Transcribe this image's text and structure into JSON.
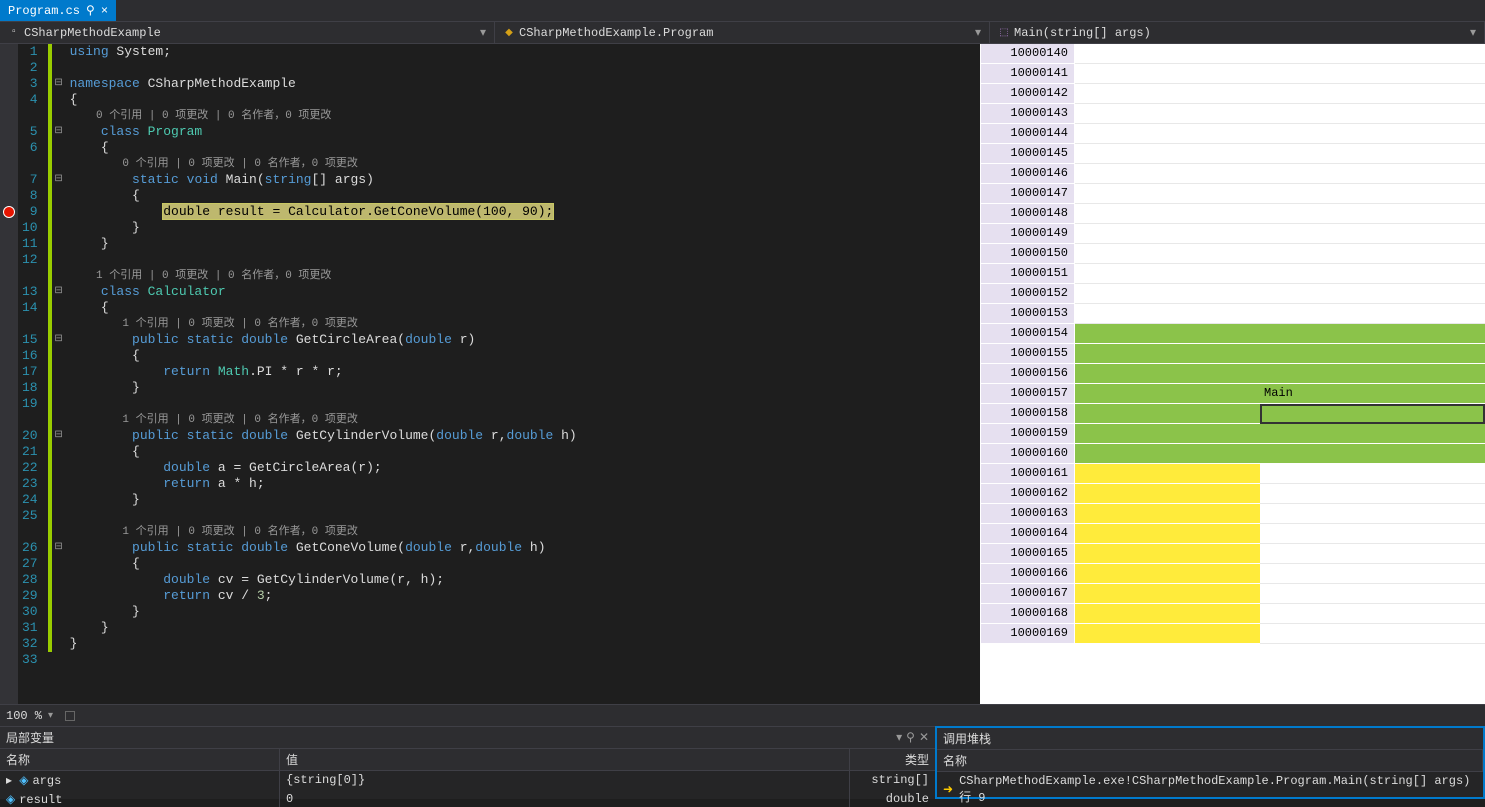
{
  "tab": {
    "name": "Program.cs",
    "close": "×"
  },
  "breadcrumb": {
    "project": "CSharpMethodExample",
    "class": "CSharpMethodExample.Program",
    "method": "Main(string[] args)"
  },
  "icons": {
    "ns": "▫",
    "cls": "◆",
    "meth": "⬚",
    "chev": "▾",
    "fold": "⊟",
    "foldc": "⊞",
    "pin": "⚲",
    "close": "✕",
    "tri": "▸",
    "cube": "◈",
    "arrow": "➜"
  },
  "code": {
    "lines": [
      {
        "n": 1,
        "fold": "",
        "chg": "mod",
        "parts": [
          {
            "t": "using ",
            "c": "kw"
          },
          {
            "t": "System;",
            "c": ""
          }
        ]
      },
      {
        "n": 2,
        "fold": "",
        "chg": "mod",
        "parts": []
      },
      {
        "n": 3,
        "fold": "⊟",
        "chg": "mod",
        "parts": [
          {
            "t": "namespace ",
            "c": "kw"
          },
          {
            "t": "CSharpMethodExample",
            "c": ""
          }
        ]
      },
      {
        "n": 4,
        "fold": "",
        "chg": "mod",
        "parts": [
          {
            "t": "{",
            "c": ""
          }
        ]
      },
      {
        "n": "",
        "fold": "",
        "chg": "mod",
        "lens": "    0 个引用 | 0 项更改 | 0 名作者，0 项更改"
      },
      {
        "n": 5,
        "fold": "⊟",
        "chg": "mod",
        "parts": [
          {
            "t": "    class ",
            "c": "kw"
          },
          {
            "t": "Program",
            "c": "type"
          }
        ]
      },
      {
        "n": 6,
        "fold": "",
        "chg": "mod",
        "parts": [
          {
            "t": "    {",
            "c": ""
          }
        ]
      },
      {
        "n": "",
        "fold": "",
        "chg": "mod",
        "lens": "        0 个引用 | 0 项更改 | 0 名作者，0 项更改"
      },
      {
        "n": 7,
        "fold": "⊟",
        "chg": "mod",
        "parts": [
          {
            "t": "        static ",
            "c": "kw"
          },
          {
            "t": "void ",
            "c": "kw"
          },
          {
            "t": "Main(",
            "c": ""
          },
          {
            "t": "string",
            "c": "kw"
          },
          {
            "t": "[] args)",
            "c": ""
          }
        ]
      },
      {
        "n": 8,
        "fold": "",
        "chg": "mod",
        "parts": [
          {
            "t": "        {",
            "c": ""
          }
        ]
      },
      {
        "n": 9,
        "fold": "",
        "chg": "mod",
        "bp": true,
        "hl": true,
        "parts": [
          {
            "t": "            ",
            "c": ""
          },
          {
            "t": "double",
            "c": "kw"
          },
          {
            "t": " result = ",
            "c": ""
          },
          {
            "t": "Calculator",
            "c": "type"
          },
          {
            "t": ".GetConeVolume(",
            "c": ""
          },
          {
            "t": "100",
            "c": "num"
          },
          {
            "t": ", ",
            "c": ""
          },
          {
            "t": "90",
            "c": "num"
          },
          {
            "t": ");",
            "c": ""
          }
        ]
      },
      {
        "n": 10,
        "fold": "",
        "chg": "mod",
        "parts": [
          {
            "t": "        }",
            "c": ""
          }
        ]
      },
      {
        "n": 11,
        "fold": "",
        "chg": "mod",
        "parts": [
          {
            "t": "    }",
            "c": ""
          }
        ]
      },
      {
        "n": 12,
        "fold": "",
        "chg": "mod",
        "parts": []
      },
      {
        "n": "",
        "fold": "",
        "chg": "mod",
        "lens": "    1 个引用 | 0 项更改 | 0 名作者，0 项更改"
      },
      {
        "n": 13,
        "fold": "⊟",
        "chg": "mod",
        "parts": [
          {
            "t": "    class ",
            "c": "kw"
          },
          {
            "t": "Calculator",
            "c": "type"
          }
        ]
      },
      {
        "n": 14,
        "fold": "",
        "chg": "mod",
        "parts": [
          {
            "t": "    {",
            "c": ""
          }
        ]
      },
      {
        "n": "",
        "fold": "",
        "chg": "mod",
        "lens": "        1 个引用 | 0 项更改 | 0 名作者，0 项更改"
      },
      {
        "n": 15,
        "fold": "⊟",
        "chg": "mod",
        "parts": [
          {
            "t": "        public ",
            "c": "kw"
          },
          {
            "t": "static ",
            "c": "kw"
          },
          {
            "t": "double ",
            "c": "kw"
          },
          {
            "t": "GetCircleArea(",
            "c": ""
          },
          {
            "t": "double ",
            "c": "kw"
          },
          {
            "t": "r)",
            "c": ""
          }
        ]
      },
      {
        "n": 16,
        "fold": "",
        "chg": "mod",
        "parts": [
          {
            "t": "        {",
            "c": ""
          }
        ]
      },
      {
        "n": 17,
        "fold": "",
        "chg": "mod",
        "parts": [
          {
            "t": "            return ",
            "c": "kw"
          },
          {
            "t": "Math",
            "c": "type"
          },
          {
            "t": ".PI * r * r;",
            "c": ""
          }
        ]
      },
      {
        "n": 18,
        "fold": "",
        "chg": "mod",
        "parts": [
          {
            "t": "        }",
            "c": ""
          }
        ]
      },
      {
        "n": 19,
        "fold": "",
        "chg": "mod",
        "parts": []
      },
      {
        "n": "",
        "fold": "",
        "chg": "mod",
        "lens": "        1 个引用 | 0 项更改 | 0 名作者，0 项更改"
      },
      {
        "n": 20,
        "fold": "⊟",
        "chg": "mod",
        "parts": [
          {
            "t": "        public ",
            "c": "kw"
          },
          {
            "t": "static ",
            "c": "kw"
          },
          {
            "t": "double ",
            "c": "kw"
          },
          {
            "t": "GetCylinderVolume(",
            "c": ""
          },
          {
            "t": "double ",
            "c": "kw"
          },
          {
            "t": "r,",
            "c": ""
          },
          {
            "t": "double ",
            "c": "kw"
          },
          {
            "t": "h)",
            "c": ""
          }
        ]
      },
      {
        "n": 21,
        "fold": "",
        "chg": "mod",
        "parts": [
          {
            "t": "        {",
            "c": ""
          }
        ]
      },
      {
        "n": 22,
        "fold": "",
        "chg": "mod",
        "parts": [
          {
            "t": "            double ",
            "c": "kw"
          },
          {
            "t": "a = GetCircleArea(r);",
            "c": ""
          }
        ]
      },
      {
        "n": 23,
        "fold": "",
        "chg": "mod",
        "parts": [
          {
            "t": "            return ",
            "c": "kw"
          },
          {
            "t": "a * h;",
            "c": ""
          }
        ]
      },
      {
        "n": 24,
        "fold": "",
        "chg": "mod",
        "parts": [
          {
            "t": "        }",
            "c": ""
          }
        ]
      },
      {
        "n": 25,
        "fold": "",
        "chg": "mod",
        "parts": []
      },
      {
        "n": "",
        "fold": "",
        "chg": "mod",
        "lens": "        1 个引用 | 0 项更改 | 0 名作者，0 项更改"
      },
      {
        "n": 26,
        "fold": "⊟",
        "chg": "mod",
        "parts": [
          {
            "t": "        public ",
            "c": "kw"
          },
          {
            "t": "static ",
            "c": "kw"
          },
          {
            "t": "double ",
            "c": "kw"
          },
          {
            "t": "GetConeVolume(",
            "c": ""
          },
          {
            "t": "double ",
            "c": "kw"
          },
          {
            "t": "r,",
            "c": ""
          },
          {
            "t": "double ",
            "c": "kw"
          },
          {
            "t": "h)",
            "c": ""
          }
        ]
      },
      {
        "n": 27,
        "fold": "",
        "chg": "mod",
        "parts": [
          {
            "t": "        {",
            "c": ""
          }
        ]
      },
      {
        "n": 28,
        "fold": "",
        "chg": "mod",
        "parts": [
          {
            "t": "            double ",
            "c": "kw"
          },
          {
            "t": "cv = GetCylinderVolume(r, h);",
            "c": ""
          }
        ]
      },
      {
        "n": 29,
        "fold": "",
        "chg": "mod",
        "parts": [
          {
            "t": "            return ",
            "c": "kw"
          },
          {
            "t": "cv / ",
            "c": ""
          },
          {
            "t": "3",
            "c": "num"
          },
          {
            "t": ";",
            "c": ""
          }
        ]
      },
      {
        "n": 30,
        "fold": "",
        "chg": "mod",
        "parts": [
          {
            "t": "        }",
            "c": ""
          }
        ]
      },
      {
        "n": 31,
        "fold": "",
        "chg": "mod",
        "parts": [
          {
            "t": "    }",
            "c": ""
          }
        ]
      },
      {
        "n": 32,
        "fold": "",
        "chg": "mod",
        "parts": [
          {
            "t": "}",
            "c": ""
          }
        ]
      },
      {
        "n": 33,
        "fold": "",
        "chg": "",
        "parts": []
      }
    ]
  },
  "tree": {
    "rows": [
      {
        "id": "10000140",
        "cls": ""
      },
      {
        "id": "10000141",
        "cls": ""
      },
      {
        "id": "10000142",
        "cls": ""
      },
      {
        "id": "10000143",
        "cls": ""
      },
      {
        "id": "10000144",
        "cls": ""
      },
      {
        "id": "10000145",
        "cls": ""
      },
      {
        "id": "10000146",
        "cls": ""
      },
      {
        "id": "10000147",
        "cls": ""
      },
      {
        "id": "10000148",
        "cls": ""
      },
      {
        "id": "10000149",
        "cls": ""
      },
      {
        "id": "10000150",
        "cls": ""
      },
      {
        "id": "10000151",
        "cls": ""
      },
      {
        "id": "10000152",
        "cls": ""
      },
      {
        "id": "10000153",
        "cls": ""
      },
      {
        "id": "10000154",
        "cls": "green"
      },
      {
        "id": "10000155",
        "cls": "green"
      },
      {
        "id": "10000156",
        "cls": "green"
      },
      {
        "id": "10000157",
        "cls": "green",
        "b": "Main"
      },
      {
        "id": "10000158",
        "cls": "green",
        "sel": true
      },
      {
        "id": "10000159",
        "cls": "green"
      },
      {
        "id": "10000160",
        "cls": "green"
      },
      {
        "id": "10000161",
        "cls": "yellow"
      },
      {
        "id": "10000162",
        "cls": "yellow"
      },
      {
        "id": "10000163",
        "cls": "yellow"
      },
      {
        "id": "10000164",
        "cls": "yellow"
      },
      {
        "id": "10000165",
        "cls": "yellow"
      },
      {
        "id": "10000166",
        "cls": "yellow"
      },
      {
        "id": "10000167",
        "cls": "yellow"
      },
      {
        "id": "10000168",
        "cls": "yellow"
      },
      {
        "id": "10000169",
        "cls": "yellow"
      }
    ]
  },
  "zoom": "100 %",
  "locals": {
    "title": "局部变量",
    "cols": {
      "name": "名称",
      "value": "值",
      "type": "类型"
    },
    "rows": [
      {
        "name": "args",
        "value": "{string[0]}",
        "type": "string[]",
        "exp": "▸"
      },
      {
        "name": "result",
        "value": "0",
        "type": "double",
        "exp": ""
      }
    ]
  },
  "callstack": {
    "title": "调用堆栈",
    "col": "名称",
    "rows": [
      {
        "text": "CSharpMethodExample.exe!CSharpMethodExample.Program.Main(string[] args) 行 9"
      }
    ]
  }
}
